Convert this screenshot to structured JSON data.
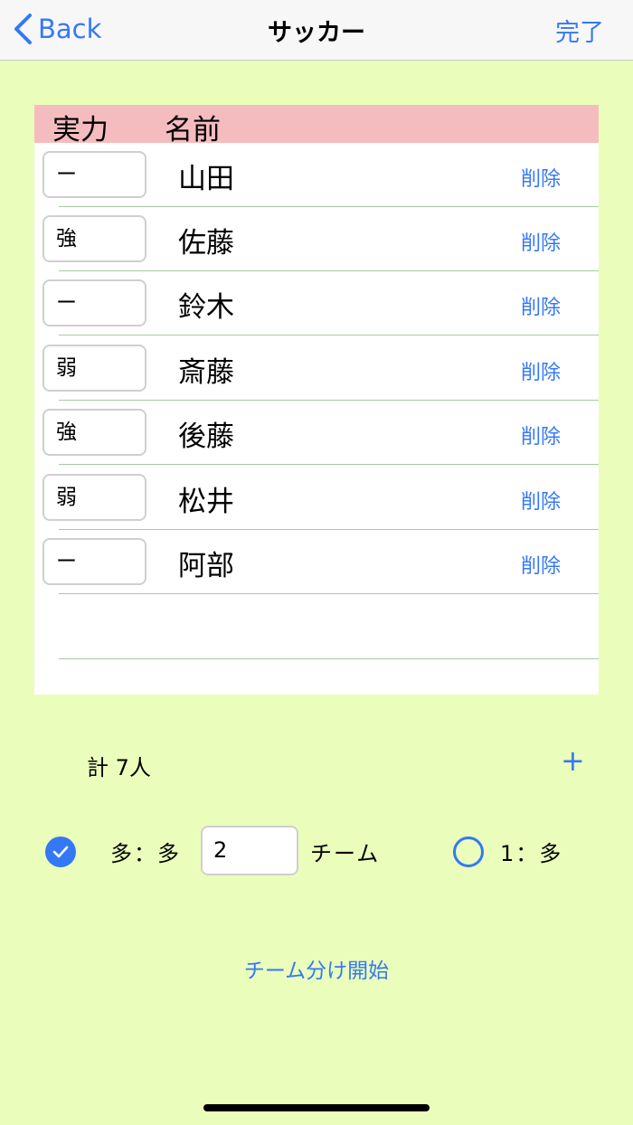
{
  "nav": {
    "back_label": "Back",
    "title": "サッカー",
    "done_label": "完了"
  },
  "table": {
    "header": {
      "power": "実力",
      "name": "名前"
    },
    "delete_label": "削除",
    "rows": [
      {
        "power": "ー",
        "name": "山田"
      },
      {
        "power": "強",
        "name": "佐藤"
      },
      {
        "power": "ー",
        "name": "鈴木"
      },
      {
        "power": "弱",
        "name": "斎藤"
      },
      {
        "power": "強",
        "name": "後藤"
      },
      {
        "power": "弱",
        "name": "松井"
      },
      {
        "power": "ー",
        "name": "阿部"
      }
    ]
  },
  "summary": {
    "total": "計 7人",
    "add": "+"
  },
  "mode": {
    "many_label": "多：多",
    "team_count": "2",
    "team_label": "チーム",
    "one_label": "1：多",
    "selected": "many"
  },
  "start_label": "チーム分け開始",
  "colors": {
    "accent": "#3478f6",
    "background": "#eafdbb",
    "header": "#f5bcc0"
  }
}
